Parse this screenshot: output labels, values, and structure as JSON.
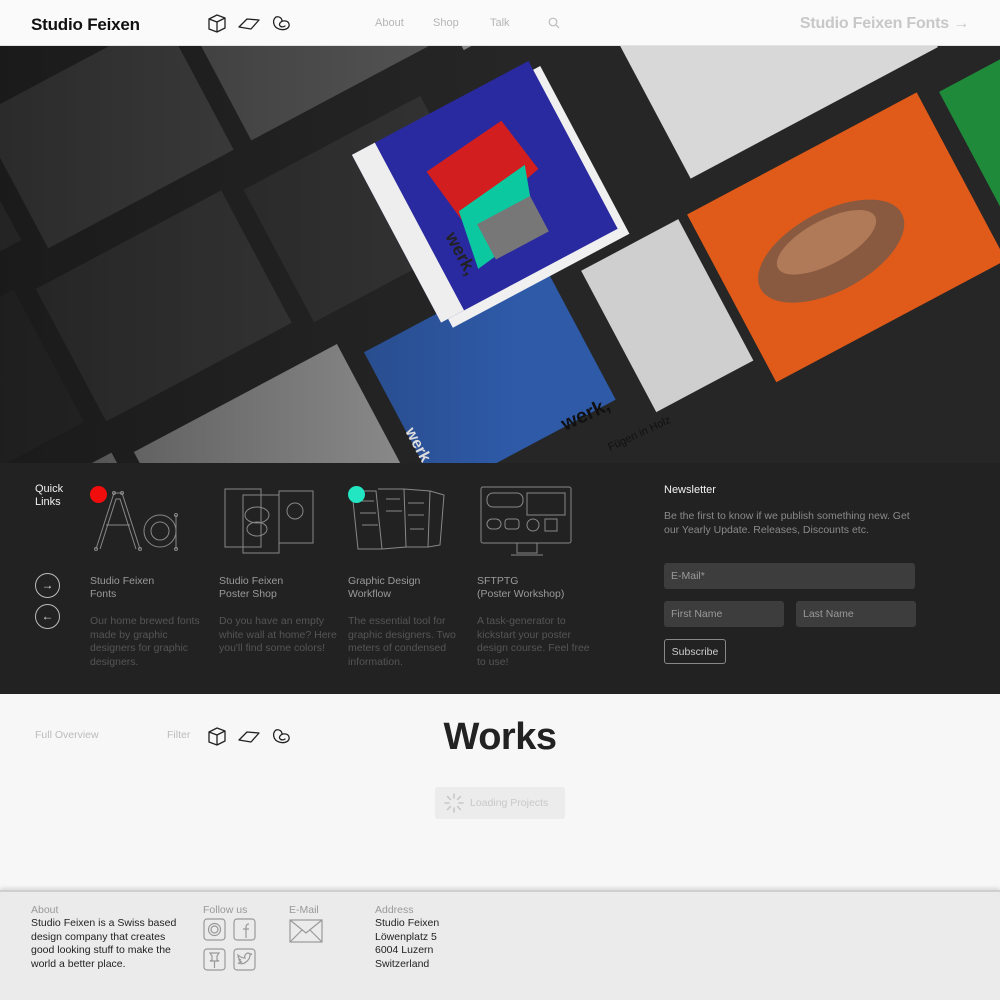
{
  "header": {
    "logo": "Studio Feixen",
    "icons": [
      "cube-icon",
      "parallelogram-icon",
      "spiral-icon"
    ],
    "nav": [
      "About",
      "Shop",
      "Talk"
    ],
    "fonts_link": "Studio Feixen Fonts →"
  },
  "hero": {
    "magazine_texts": [
      "werk,",
      "Fügen in Holz",
      "werk,",
      "werk,"
    ]
  },
  "quick_links": {
    "title": "Quick\nLinks",
    "cards": [
      {
        "title": "Studio Feixen\nFonts",
        "desc": "Our home brewed fonts made by graphic designers for graphic designers.",
        "dot": "#f20d0d"
      },
      {
        "title": "Studio Feixen\nPoster Shop",
        "desc": "Do you have an empty white wall at home? Here you'll find some colors!"
      },
      {
        "title": "Graphic Design\nWorkflow",
        "desc": "The essential tool for graphic designers. Two meters of condensed information.",
        "dot": "#21e6c1"
      },
      {
        "title": "SFTPTG\n(Poster Workshop)",
        "desc": "A task-generator to kickstart your poster design course. Feel free to use!"
      }
    ]
  },
  "newsletter": {
    "title": "Newsletter",
    "text": "Be the first to know if we publish something new. Get our Yearly Update. Releases, Discounts etc.",
    "email_placeholder": "E-Mail*",
    "first_name_placeholder": "First Name",
    "last_name_placeholder": "Last Name",
    "subscribe": "Subscribe"
  },
  "works": {
    "full_overview": "Full Overview",
    "filter": "Filter",
    "title": "Works",
    "loading": "Loading Projects"
  },
  "footer": {
    "about_label": "About",
    "about_text": "Studio Feixen is a Swiss based design company that creates good looking stuff to make the world a better place.",
    "follow_label": "Follow us",
    "social_icons": [
      "instagram-icon",
      "facebook-icon",
      "pinterest-icon",
      "twitter-icon"
    ],
    "email_label": "E-Mail",
    "address_label": "Address",
    "address": "Studio Feixen\nLöwenplatz 5\n6004 Luzern\nSwitzerland"
  },
  "colors": {
    "red_dot": "#f20d0d",
    "mint_dot": "#21e6c1",
    "panel_bg": "#222222"
  }
}
